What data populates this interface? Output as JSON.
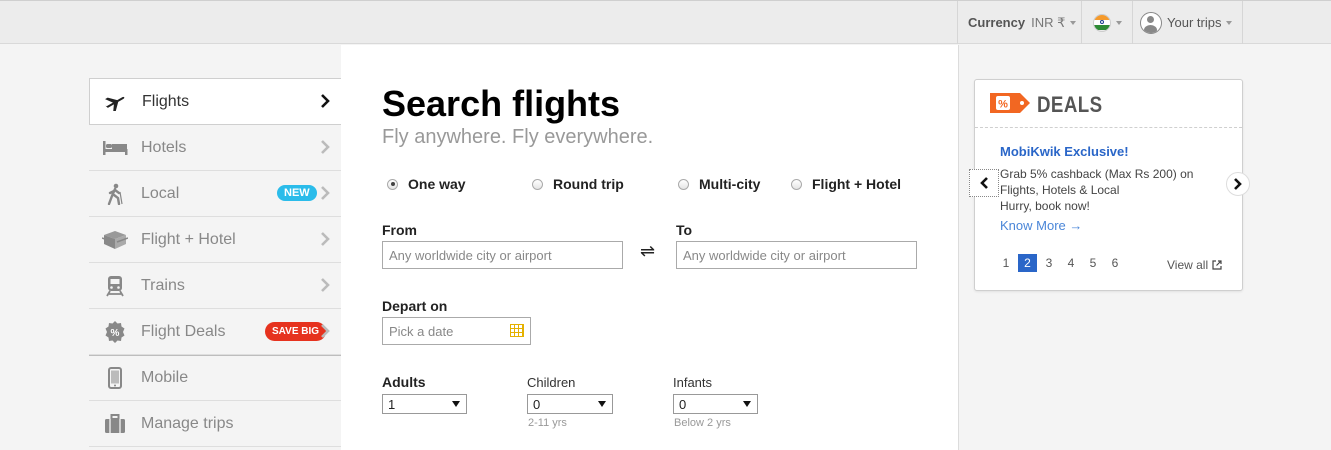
{
  "topbar": {
    "currency_label": "Currency",
    "currency_value": "INR ₹",
    "flag": {
      "colors": [
        "#f59a2b",
        "#ffffff",
        "#2e8b35"
      ]
    },
    "your_trips": "Your trips"
  },
  "sidebar": {
    "items": [
      {
        "label": "Flights",
        "icon": "plane-icon",
        "active": true
      },
      {
        "label": "Hotels",
        "icon": "bed-icon"
      },
      {
        "label": "Local",
        "icon": "hiker-icon",
        "badge": "NEW"
      },
      {
        "label": "Flight + Hotel",
        "icon": "package-icon"
      },
      {
        "label": "Trains",
        "icon": "train-icon"
      },
      {
        "label": "Flight Deals",
        "icon": "percent-icon",
        "badge": "SAVE BIG"
      },
      {
        "label": "Mobile",
        "icon": "mobile-icon"
      },
      {
        "label": "Manage trips",
        "icon": "briefcase-icon"
      }
    ]
  },
  "search": {
    "title": "Search flights",
    "subtitle": "Fly anywhere. Fly everywhere.",
    "trip_types": [
      "One way",
      "Round trip",
      "Multi-city",
      "Flight + Hotel"
    ],
    "selected_trip_type": "One way",
    "from_label": "From",
    "from_placeholder": "Any worldwide city or airport",
    "to_label": "To",
    "to_placeholder": "Any worldwide city or airport",
    "swap_symbol": "⇌",
    "depart_label": "Depart on",
    "depart_placeholder": "Pick a date",
    "adults_label": "Adults",
    "adults_value": "1",
    "children_label": "Children",
    "children_value": "0",
    "children_hint": "2-11 yrs",
    "infants_label": "Infants",
    "infants_value": "0",
    "infants_hint": "Below 2 yrs"
  },
  "deals": {
    "title": "DEALS",
    "tag_symbol": "%",
    "deal_name": "MobiKwik Exclusive!",
    "deal_desc_1": "Grab 5% cashback (Max Rs 200) on",
    "deal_desc_2": "Flights, Hotels & Local",
    "deal_desc_3": "Hurry, book now!",
    "know_more": "Know More →",
    "pages": [
      "1",
      "2",
      "3",
      "4",
      "5",
      "6"
    ],
    "current_page": "2",
    "view_all": "View all",
    "colors": {
      "tag": "#f26722",
      "link": "#2a66c8"
    }
  }
}
